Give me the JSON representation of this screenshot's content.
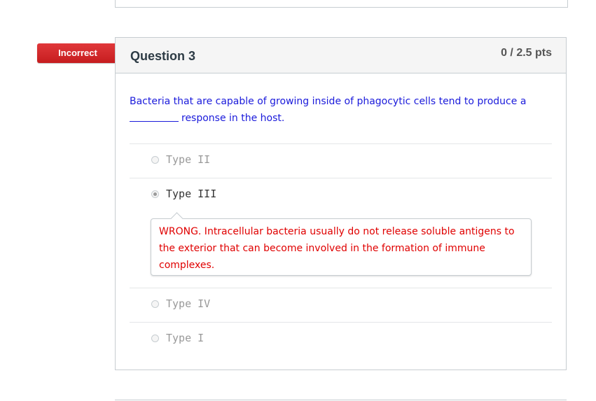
{
  "status": {
    "label": "Incorrect",
    "color": "#d02a2c"
  },
  "question": {
    "title": "Question 3",
    "points": "0 / 2.5 pts",
    "text_before": "Bacteria that are capable of growing inside of phagocytic cells tend to produce a",
    "text_after": "response in the host."
  },
  "answers": [
    {
      "label": "Type II",
      "selected": false
    },
    {
      "label": "Type III",
      "selected": true
    },
    {
      "label": "Type IV",
      "selected": false
    },
    {
      "label": "Type I",
      "selected": false
    }
  ],
  "feedback": {
    "text": "WRONG. Intracellular bacteria usually do not release soluble antigens to the exterior that can become involved in the formation of immune complexes.",
    "color": "#e00000"
  }
}
